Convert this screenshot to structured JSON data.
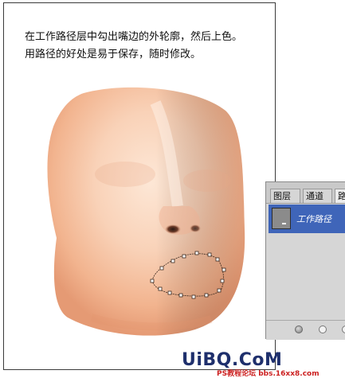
{
  "instruction": {
    "line1": "在工作路径层中勾出嘴边的外轮廓，然后上色。",
    "line2": "用路径的好处是易于保存，随时修改。"
  },
  "panel": {
    "tabs": [
      "图层",
      "通道",
      "路"
    ],
    "path_name": "工作路径"
  },
  "watermark": {
    "logo": "UiBQ.CoM",
    "sub": "PS教程论坛 bbs.16xx8.com"
  },
  "colors": {
    "skin_light": "#fbd9c2",
    "skin_mid": "#f2b895",
    "selection_blue": "#3f65b9",
    "panel_gray": "#d6d6d6"
  }
}
